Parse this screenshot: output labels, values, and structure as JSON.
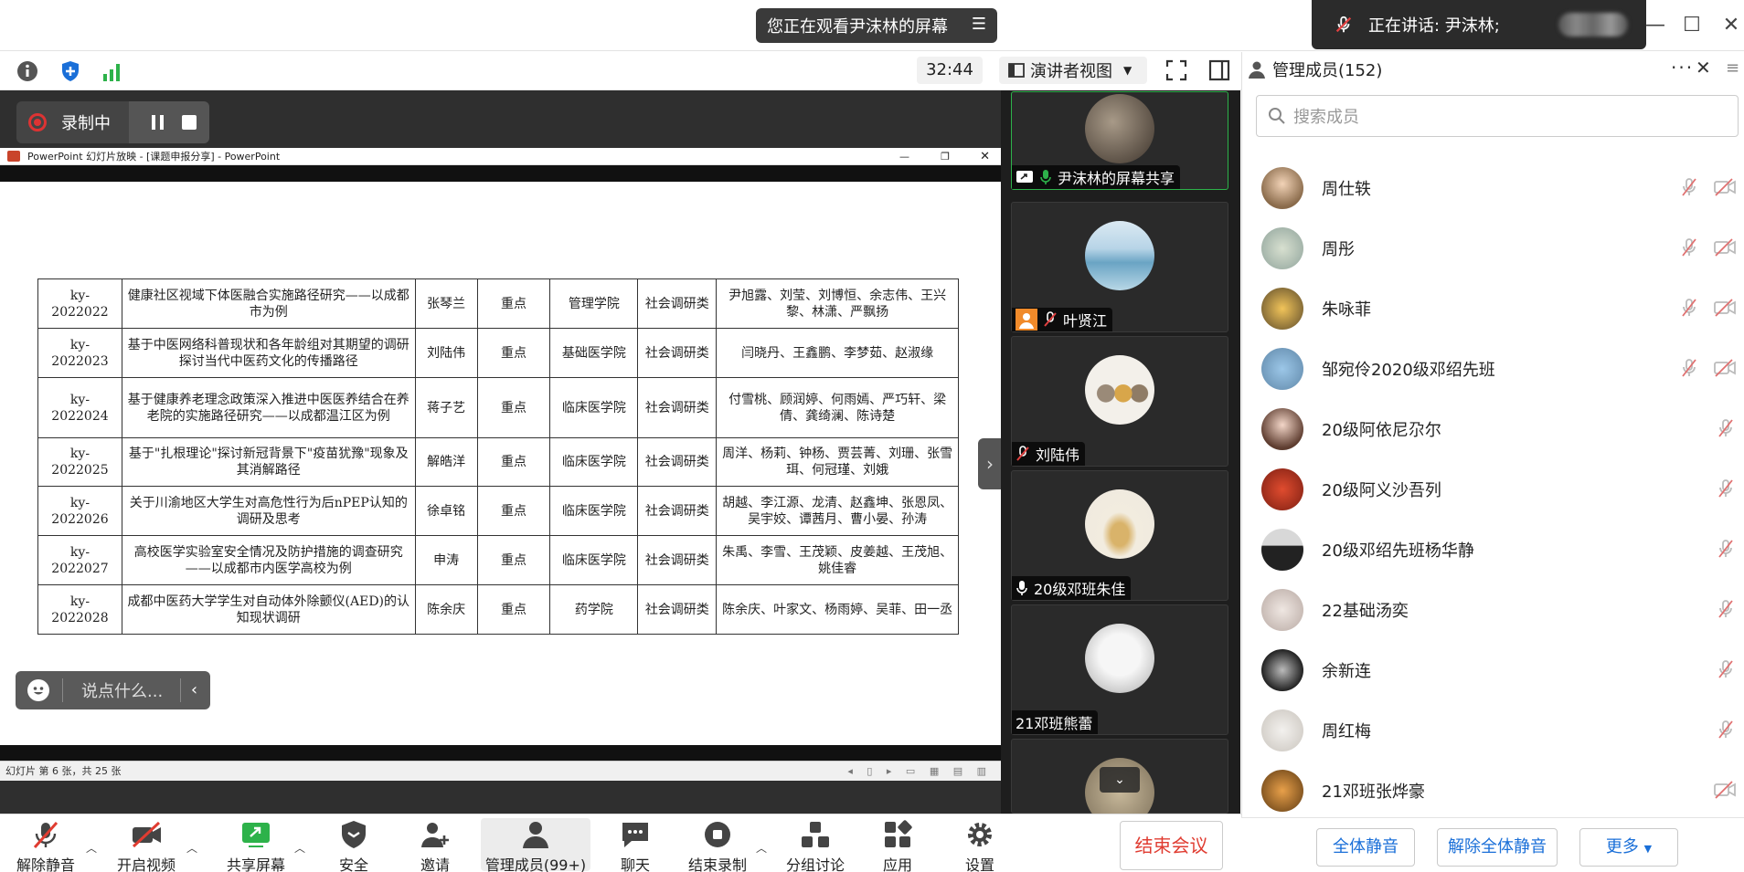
{
  "top": {
    "watching_label": "您正在观看尹沫林的屏幕",
    "speaking_label": "正在讲话: 尹沫林;"
  },
  "toolbar": {
    "timer": "32:44",
    "view_mode": "演讲者视图"
  },
  "recording": {
    "label": "录制中"
  },
  "ppt": {
    "title": "PowerPoint 幻灯片放映 - [课题申报分享] - PowerPoint",
    "status": "幻灯片 第 6 张，共 25 张",
    "rows": [
      {
        "id": "ky-2022022",
        "title": "健康社区视域下体医融合实施路径研究——以成都市为例",
        "leader": "张琴兰",
        "level": "重点",
        "college": "管理学院",
        "type": "社会调研类",
        "members": "尹旭露、刘莹、刘博恒、余志伟、王兴黎、林潇、严飘扬"
      },
      {
        "id": "ky-2022023",
        "title": "基于中医网络科普现状和各年龄组对其期望的调研探讨当代中医药文化的传播路径",
        "leader": "刘陆伟",
        "level": "重点",
        "college": "基础医学院",
        "type": "社会调研类",
        "members": "闫晓丹、王鑫鹏、李梦茹、赵淑缘"
      },
      {
        "id": "ky-2022024",
        "title": "基于健康养老理念政策深入推进中医医养结合在养老院的实施路径研究——以成都温江区为例",
        "leader": "蒋子艺",
        "level": "重点",
        "college": "临床医学院",
        "type": "社会调研类",
        "members": "付雪桃、顾润婷、何雨嫣、严巧轩、梁倩、龚绮澜、陈诗楚"
      },
      {
        "id": "ky-2022025",
        "title": "基于\"扎根理论\"探讨新冠背景下\"疫苗犹豫\"现象及其消解路径",
        "leader": "解皓洋",
        "level": "重点",
        "college": "临床医学院",
        "type": "社会调研类",
        "members": "周洋、杨莉、钟杨、贾芸菁、刘珊、张雪珥、何冠瑾、刘娥"
      },
      {
        "id": "ky-2022026",
        "title": "关于川渝地区大学生对高危性行为后nPEP认知的调研及思考",
        "leader": "徐卓铭",
        "level": "重点",
        "college": "临床医学院",
        "type": "社会调研类",
        "members": "胡越、李江源、龙清、赵鑫坤、张恩凤、吴宇姣、谭茜月、曹小晏、孙涛"
      },
      {
        "id": "ky-2022027",
        "title": "高校医学实验室安全情况及防护措施的调查研究——以成都市内医学高校为例",
        "leader": "申涛",
        "level": "重点",
        "college": "临床医学院",
        "type": "社会调研类",
        "members": "朱禹、李雪、王茂颖、皮姜越、王茂旭、姚佳睿"
      },
      {
        "id": "ky-2022028",
        "title": "成都中医药大学学生对自动体外除颤仪(AED)的认知现状调研",
        "leader": "陈余庆",
        "level": "重点",
        "college": "药学院",
        "type": "社会调研类",
        "members": "陈余庆、叶家文、杨雨婷、吴菲、田一丞"
      }
    ]
  },
  "chat": {
    "placeholder": "说点什么..."
  },
  "tiles": [
    {
      "name": "尹沫林的屏幕共享"
    },
    {
      "name": "叶贤江"
    },
    {
      "name": "刘陆伟"
    },
    {
      "name": "20级邓班朱佳"
    },
    {
      "name": "21邓班熊蕾"
    }
  ],
  "panel": {
    "title": "管理成员(152)",
    "search_placeholder": "搜索成员",
    "members": [
      {
        "name": "周仕轶"
      },
      {
        "name": "周彤"
      },
      {
        "name": "朱咏菲"
      },
      {
        "name": "邹宛伶2020级邓绍先班"
      },
      {
        "name": "20级阿依尼尕尔"
      },
      {
        "name": "20级阿义沙吾列"
      },
      {
        "name": "20级邓绍先班杨华静"
      },
      {
        "name": "22基础汤奕"
      },
      {
        "name": "余新连"
      },
      {
        "name": "周红梅"
      },
      {
        "name": "21邓班张烨豪"
      }
    ],
    "mute_all": "全体静音",
    "unmute_all": "解除全体静音",
    "more": "更多"
  },
  "bottom": {
    "unmute": "解除静音",
    "start_video": "开启视频",
    "share_screen": "共享屏幕",
    "security": "安全",
    "invite": "邀请",
    "manage_members": "管理成员(99+)",
    "chat": "聊天",
    "end_recording": "结束录制",
    "breakout": "分组讨论",
    "apps": "应用",
    "settings": "设置",
    "end_meeting": "结束会议"
  }
}
